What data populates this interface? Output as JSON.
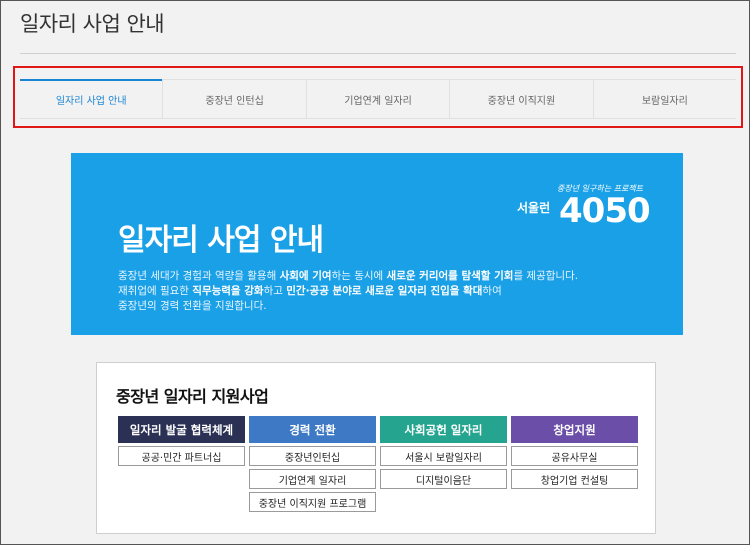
{
  "page": {
    "title": "일자리 사업 안내"
  },
  "tabs": [
    {
      "label": "일자리 사업 안내"
    },
    {
      "label": "중장년 인턴십"
    },
    {
      "label": "기업연계 일자리"
    },
    {
      "label": "중장년 이직지원"
    },
    {
      "label": "보람일자리"
    }
  ],
  "hero": {
    "title": "일자리 사업 안내",
    "line1_a": "중장년 세대가 경험과 역량을 활용해 ",
    "line1_b": "사회에 기여",
    "line1_c": "하는 동시에 ",
    "line1_d": "새로운 커리어를 탐색할 기회",
    "line1_e": "를 제공합니다.",
    "line2_a": "재취업에 필요한 ",
    "line2_b": "직무능력을 강화",
    "line2_c": "하고 ",
    "line2_d": "민간·공공 분야로 새로운 일자리 진입을 확대",
    "line2_e": "하여",
    "line3": "중장년의 경력 전환을 지원합니다.",
    "logo_tagline": "중장년 일구하는 프로젝트",
    "logo_seoul": "서울런",
    "logo_number": "4050"
  },
  "support": {
    "title": "중장년 일자리 지원사업",
    "columns": [
      {
        "head": "일자리 발굴 협력체계",
        "color": "#2b3055",
        "items": [
          "공공·민간 파트너십"
        ]
      },
      {
        "head": "경력 전환",
        "color": "#3d79c4",
        "items": [
          "중장년인턴십",
          "기업연계 일자리",
          "중장년 이직지원 프로그램"
        ]
      },
      {
        "head": "사회공헌 일자리",
        "color": "#25a58f",
        "items": [
          "서울시 보람일자리",
          "디지털이음단"
        ]
      },
      {
        "head": "창업지원",
        "color": "#6b4ea8",
        "items": [
          "공유사무실",
          "창업기업 컨설팅"
        ]
      }
    ]
  }
}
